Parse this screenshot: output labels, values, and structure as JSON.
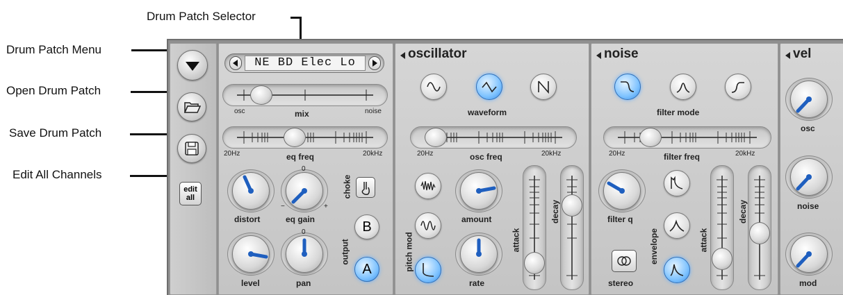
{
  "callouts": {
    "patch_selector": "Drum Patch Selector",
    "patch_menu": "Drum Patch Menu",
    "open_patch": "Open Drum Patch",
    "save_patch": "Save Drum Patch",
    "edit_all_channels": "Edit All Channels"
  },
  "sidebar": {
    "edit_all_line1": "edit",
    "edit_all_line2": "all"
  },
  "mix_section": {
    "patch_name": "NE BD Elec Lo",
    "mix_left": "osc",
    "mix_label": "mix",
    "mix_right": "noise",
    "eq_min": "20Hz",
    "eq_label": "eq freq",
    "eq_max": "20kHz",
    "distort_label": "distort",
    "eq_gain_label": "eq gain",
    "choke_label": "choke",
    "level_label": "level",
    "pan_label": "pan",
    "output_label": "output",
    "output_b": "B",
    "output_a": "A",
    "minus": "−",
    "plus": "+",
    "zero": "0"
  },
  "oscillator": {
    "title": "oscillator",
    "waveform_label": "waveform",
    "freq_min": "20Hz",
    "freq_label": "osc freq",
    "freq_max": "20kHz",
    "amount_label": "amount",
    "pitch_mod_label": "pitch mod",
    "rate_label": "rate",
    "attack_label": "attack",
    "decay_label": "decay"
  },
  "noise": {
    "title": "noise",
    "filter_mode_label": "filter mode",
    "freq_min": "20Hz",
    "freq_label": "filter freq",
    "freq_max": "20kHz",
    "filter_q_label": "filter q",
    "envelope_label": "envelope",
    "stereo_label": "stereo",
    "attack_label": "attack",
    "decay_label": "decay"
  },
  "vel": {
    "title": "vel",
    "osc_label": "osc",
    "noise_label": "noise",
    "mod_label": "mod"
  },
  "colors": {
    "accent_blue": "#1f5fbf",
    "active_button": "#7fc3ff",
    "panel_bg": "#cfcfcf",
    "frame_bg": "#8f8f8f"
  }
}
